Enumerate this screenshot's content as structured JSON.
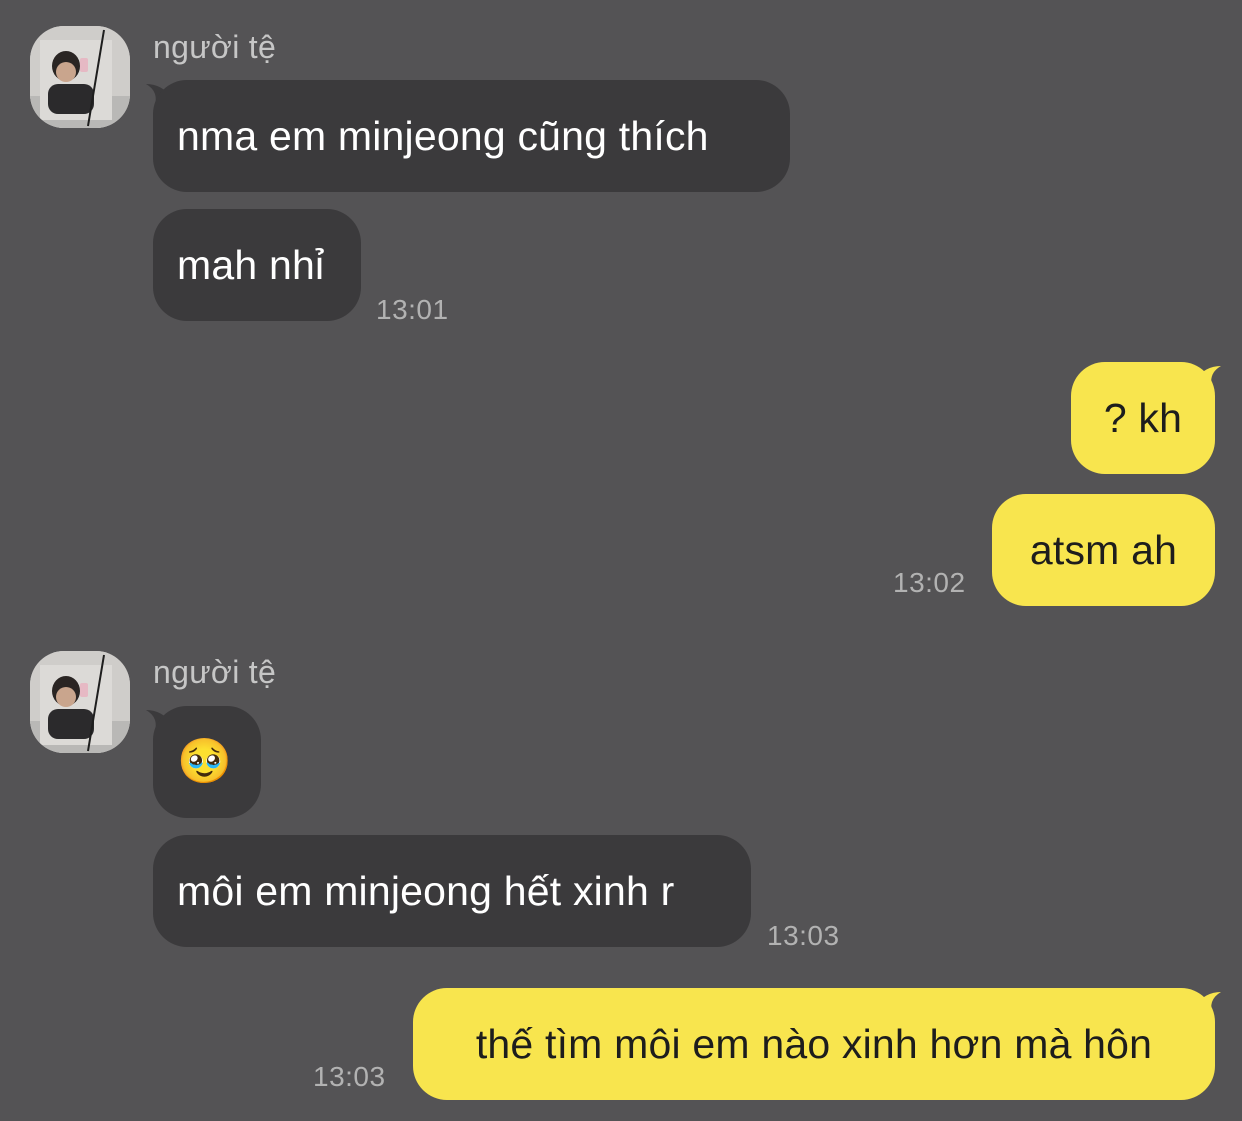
{
  "chat": {
    "colors": {
      "background": "#545355",
      "incoming_bubble": "#3b3a3c",
      "outgoing_bubble": "#f8e54e",
      "timestamp": "#b2b2b2",
      "sender_name": "#c6c6c6"
    },
    "groups": [
      {
        "sender": "người tệ",
        "messages": [
          "nma em minjeong cũng thích",
          "mah nhỉ"
        ],
        "time": "13:01"
      },
      {
        "sender": "me",
        "messages": [
          "? kh",
          "atsm ah"
        ],
        "time": "13:02"
      },
      {
        "sender": "người tệ",
        "messages": [
          "🥹",
          "môi em minjeong hết xinh r"
        ],
        "time": "13:03"
      },
      {
        "sender": "me",
        "messages": [
          "thế tìm môi em nào xinh hơn mà hôn"
        ],
        "time": "13:03"
      }
    ]
  }
}
